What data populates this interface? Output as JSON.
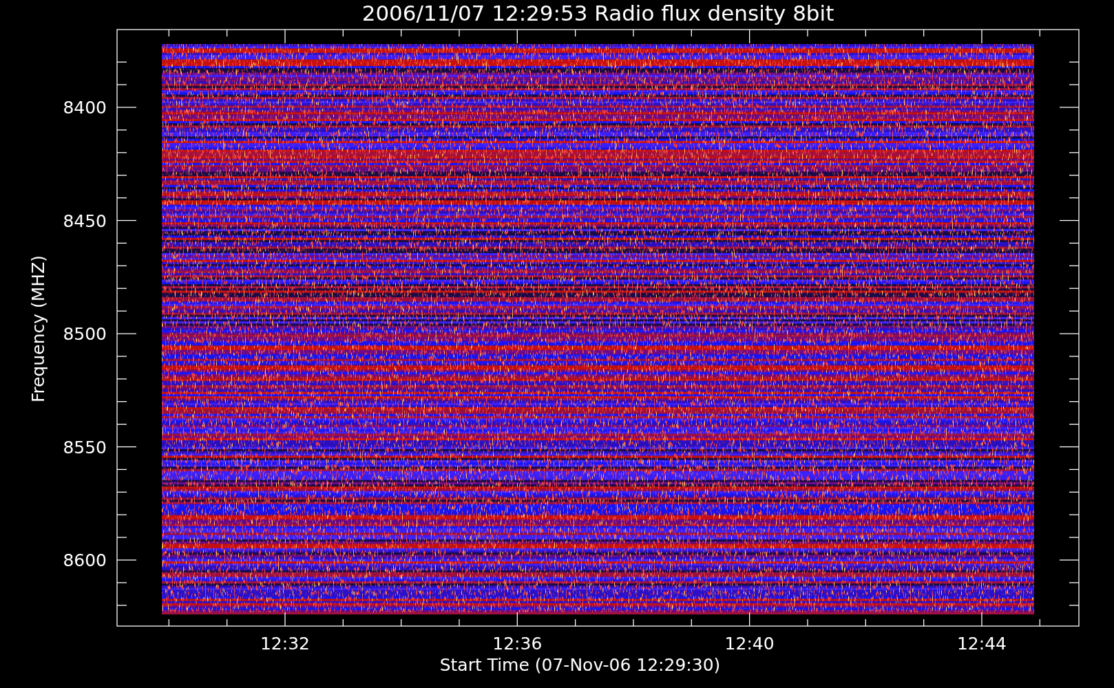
{
  "title": "2006/11/07 12:29:53 Radio flux density 8bit",
  "plot": {
    "xlabel": "Start Time (07-Nov-06 12:29:30)",
    "ylabel": "Frequency (MHZ)",
    "xticks": [
      "12:32",
      "12:36",
      "12:40",
      "12:44"
    ],
    "yticks": [
      "8400",
      "8450",
      "8500",
      "8550",
      "8600"
    ]
  }
}
